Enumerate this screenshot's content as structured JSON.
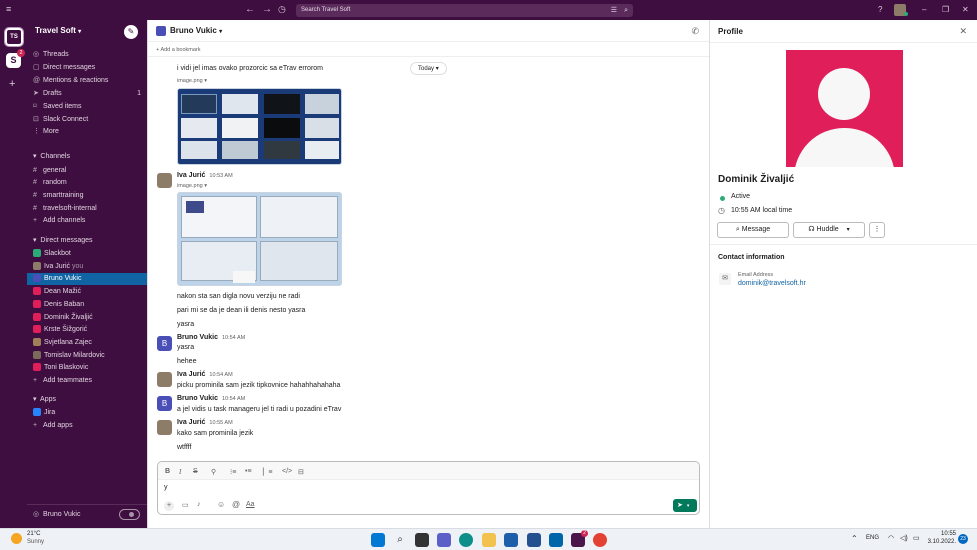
{
  "topbar": {
    "search_placeholder": "Search Travel Soft",
    "menu_icon": "hamburger-icon",
    "back_icon": "arrow-left-icon",
    "forward_icon": "arrow-right-icon",
    "history_icon": "clock-icon",
    "help_icon": "help-icon",
    "window_controls": [
      "minimize-icon",
      "restore-icon",
      "close-icon"
    ]
  },
  "workspace": {
    "initials": "TS",
    "second_badge": "2"
  },
  "sidebar": {
    "workspace_name": "Travel Soft",
    "top_items": [
      {
        "icon": "threads-icon",
        "label": "Threads"
      },
      {
        "icon": "dm-icon",
        "label": "Direct messages"
      },
      {
        "icon": "mentions-icon",
        "label": "Mentions & reactions"
      },
      {
        "icon": "drafts-icon",
        "label": "Drafts",
        "count": "1"
      },
      {
        "icon": "bookmark-icon",
        "label": "Saved items"
      },
      {
        "icon": "slack-connect-icon",
        "label": "Slack Connect"
      },
      {
        "icon": "more-icon",
        "label": "More"
      }
    ],
    "channels_header": "Channels",
    "channels": [
      "general",
      "random",
      "smarttraining",
      "travelsoft-internal"
    ],
    "add_channels": "Add channels",
    "dm_header": "Direct messages",
    "dms": [
      {
        "name": "Slackbot",
        "suffix": "",
        "color": "#2bac76"
      },
      {
        "name": "Iva Jurić",
        "suffix": "you",
        "color": "#8d7c67"
      },
      {
        "name": "Bruno Vukic",
        "suffix": "",
        "color": "#4a4fb8"
      },
      {
        "name": "Dean Mažić",
        "suffix": "",
        "color": "#e01e5a"
      },
      {
        "name": "Denis Baban",
        "suffix": "",
        "color": "#e01e5a"
      },
      {
        "name": "Dominik Živaljić",
        "suffix": "",
        "color": "#e01e5a"
      },
      {
        "name": "Krste Šižgorić",
        "suffix": "",
        "color": "#e01e5a"
      },
      {
        "name": "Svjetlana Zajec",
        "suffix": "",
        "color": "#a08058"
      },
      {
        "name": "Tomislav Milardovic",
        "suffix": "",
        "color": "#7a6a5a"
      },
      {
        "name": "Toni Blaskovic",
        "suffix": "",
        "color": "#e01e5a"
      }
    ],
    "add_teammates": "Add teammates",
    "apps_header": "Apps",
    "apps": [
      "Jira"
    ],
    "add_apps": "Add apps",
    "footer_user": "Bruno Vukic"
  },
  "channel": {
    "title": "Bruno Vukic",
    "add_bookmark": "Add a bookmark",
    "date_divider": "Today"
  },
  "messages": {
    "m0_text": "i vidi jel imas ovako prozorcic sa eTrav errorom",
    "m0_img_label": "image.png",
    "m1_name": "Iva Jurić",
    "m1_time": "10:53 AM",
    "m1_img_label": "image.png",
    "m1_l2": "nakon sta san digla novu verziju ne radi",
    "m1_l3": "pari mi se da je dean ili denis nesto yasra",
    "m1_l4": "yasra",
    "m2_name": "Bruno Vukic",
    "m2_time": "10:54 AM",
    "m2_initial": "B",
    "m2_l1": "yasra",
    "m2_l2": "hehee",
    "m3_name": "Iva Jurić",
    "m3_time": "10:54 AM",
    "m3_l1": "picku prominila sam jezik tipkovnice hahahhahahaha",
    "m4_name": "Bruno Vukic",
    "m4_time": "10:54 AM",
    "m4_initial": "B",
    "m4_l1": "a jel vidis u task manageru jel ti radi u pozadini eTrav",
    "m5_name": "Iva Jurić",
    "m5_time": "10:55 AM",
    "m5_l1": "kako sam prominila jezik",
    "m5_l2": "wtffff"
  },
  "composer": {
    "value": "y",
    "format_icons": [
      "bold-icon",
      "italic-icon",
      "strikethrough-icon",
      "link-icon",
      "ordered-list-icon",
      "bullet-list-icon",
      "blockquote-icon",
      "code-icon",
      "code-block-icon"
    ],
    "bottom_icons": [
      "plus-icon",
      "video-icon",
      "mic-icon",
      "emoji-icon",
      "mention-icon",
      "formatting-icon"
    ]
  },
  "profile": {
    "header": "Profile",
    "name": "Dominik Živaljić",
    "status": "Active",
    "local_time": "10:55 AM local time",
    "message_button": "Message",
    "huddle_button": "Huddle",
    "contact_header": "Contact information",
    "email_label": "Email Address",
    "email_value": "dominik@travelsoft.hr",
    "avatar_color": "#e01e5a"
  },
  "taskbar": {
    "weather_temp": "21°C",
    "weather_desc": "Sunny",
    "lang": "ENG",
    "time": "10:55",
    "date": "3.10.2022.",
    "notif_count": "23"
  },
  "colors": {
    "sidebar_bg": "#3f0e40",
    "active_item": "#1164a3",
    "send_green": "#007a5a",
    "link_blue": "#1264a3"
  }
}
